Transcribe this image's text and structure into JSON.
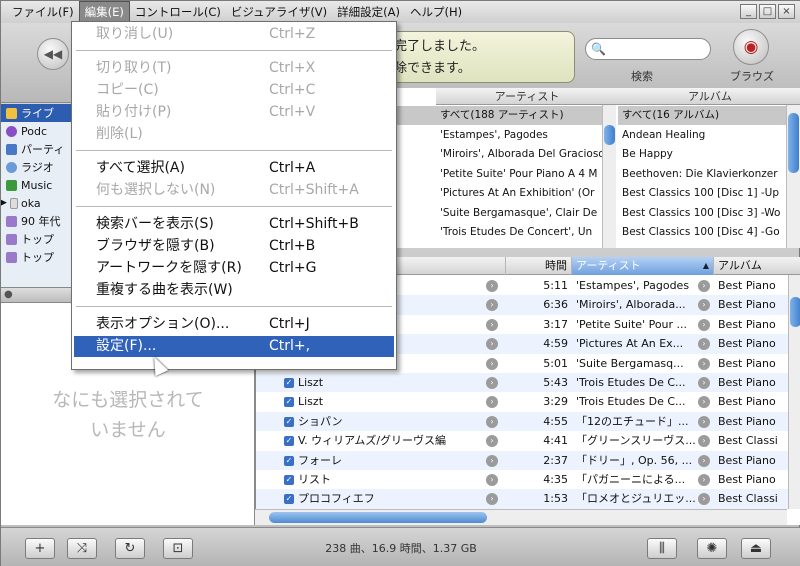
{
  "menubar": {
    "items": [
      "ファイル(F)",
      "編集(E)",
      "コントロール(C)",
      "ビジュアライザ(V)",
      "詳細設定(A)",
      "ヘルプ(H)"
    ],
    "window_buttons": [
      "_",
      "□",
      "×"
    ]
  },
  "toolbar": {
    "lcd_line1": "完了しました。",
    "lcd_line2": "除できます。",
    "search_label": "検索",
    "browse_label": "ブラウズ"
  },
  "edit_menu": {
    "items": [
      {
        "label": "取り消し(U)",
        "shortcut": "Ctrl+Z",
        "enabled": false
      },
      {
        "label": "切り取り(T)",
        "shortcut": "Ctrl+X",
        "enabled": false
      },
      {
        "label": "コピー(C)",
        "shortcut": "Ctrl+C",
        "enabled": false
      },
      {
        "label": "貼り付け(P)",
        "shortcut": "Ctrl+V",
        "enabled": false
      },
      {
        "label": "削除(L)",
        "shortcut": "",
        "enabled": false
      },
      {
        "label": "すべて選択(A)",
        "shortcut": "Ctrl+A",
        "enabled": true
      },
      {
        "label": "何も選択しない(N)",
        "shortcut": "Ctrl+Shift+A",
        "enabled": false
      },
      {
        "label": "検索バーを表示(S)",
        "shortcut": "Ctrl+Shift+B",
        "enabled": true
      },
      {
        "label": "ブラウザを隠す(B)",
        "shortcut": "Ctrl+B",
        "enabled": true
      },
      {
        "label": "アートワークを隠す(R)",
        "shortcut": "Ctrl+G",
        "enabled": true
      },
      {
        "label": "重複する曲を表示(W)",
        "shortcut": "",
        "enabled": true
      },
      {
        "label": "表示オプション(O)...",
        "shortcut": "Ctrl+J",
        "enabled": true
      },
      {
        "label": "設定(F)...",
        "shortcut": "Ctrl+,",
        "enabled": true,
        "highlighted": true
      }
    ]
  },
  "source": {
    "items": [
      "ライブ",
      "Podc",
      "パーティ",
      "ラジオ",
      "Music",
      "oka",
      "90 年代",
      "トップ",
      "トップ"
    ]
  },
  "empty_message": [
    "なにも選択されて",
    "いません"
  ],
  "browser": {
    "artist_header": "アーティスト",
    "album_header": "アルバム",
    "artists": [
      "すべて(188 アーティスト)",
      "'Estampes', Pagodes",
      "'Miroirs', Alborada Del Gracioso",
      "'Petite Suite' Pour Piano A 4 M",
      "'Pictures At An Exhibition' (Or",
      "'Suite Bergamasque', Clair De",
      "'Trois Etudes De Concert', Un"
    ],
    "albums": [
      "すべて(16 アルバム)",
      "Andean Healing",
      "Be Happy",
      "Beethoven: Die Klavierkonzer",
      "Best Classics 100 [Disc 1] -Up",
      "Best Classics 100 [Disc 3] -Wo",
      "Best Classics 100 [Disc 4] -Go"
    ]
  },
  "tracks": {
    "headers": {
      "time": "時間",
      "artist": "アーティスト",
      "album": "アルバム"
    },
    "rows": [
      {
        "name": "",
        "time": "5:11",
        "artist": "'Estampes', Pagodes",
        "album": "Best Piano"
      },
      {
        "name": "",
        "time": "6:36",
        "artist": "'Miroirs', Alborada...",
        "album": "Best Piano"
      },
      {
        "name": "",
        "time": "3:17",
        "artist": "'Petite Suite' Pour ...",
        "album": "Best Piano"
      },
      {
        "name": "",
        "time": "4:59",
        "artist": "'Pictures At An Ex...",
        "album": "Best Piano"
      },
      {
        "name": "",
        "time": "5:01",
        "artist": "'Suite Bergamasq...",
        "album": "Best Piano"
      },
      {
        "name": "Liszt",
        "time": "5:43",
        "artist": "'Trois Etudes De C...",
        "album": "Best Piano"
      },
      {
        "name": "Liszt",
        "time": "3:29",
        "artist": "'Trois Etudes De C...",
        "album": "Best Piano"
      },
      {
        "name": "ショパン",
        "time": "4:55",
        "artist": "「12のエチュード」...",
        "album": "Best Piano"
      },
      {
        "name": "V. ウィリアムズ/グリーヴス編",
        "time": "4:41",
        "artist": "「グリーンスリーヴス...",
        "album": "Best Classi"
      },
      {
        "name": "フォーレ",
        "time": "2:37",
        "artist": "「ドリー」, Op. 56, ...",
        "album": "Best Piano"
      },
      {
        "name": "リスト",
        "time": "4:35",
        "artist": "「パガニーニによる...",
        "album": "Best Piano"
      },
      {
        "name": "プロコフィエフ",
        "time": "1:53",
        "artist": "「ロメオとジュリエッ...",
        "album": "Best Classi"
      }
    ]
  },
  "status": {
    "summary": "238 曲、16.9 時間、1.37 GB"
  }
}
